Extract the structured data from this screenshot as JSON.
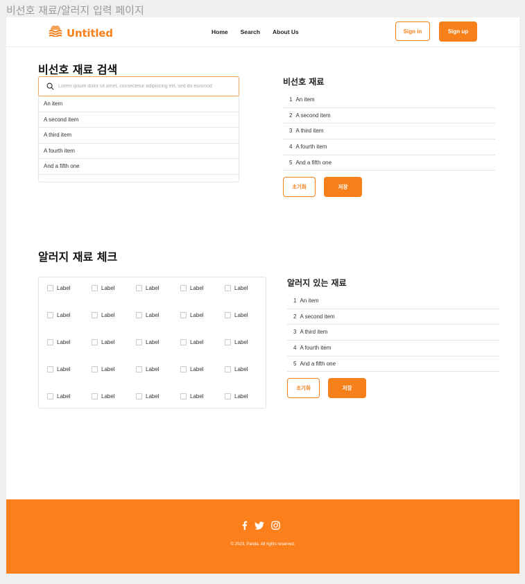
{
  "frame_title": "비선호 재료/알러지 입력 페이지",
  "header": {
    "brand": "Untitled",
    "nav": [
      "Home",
      "Search",
      "About Us"
    ],
    "sign_in": "Sign in",
    "sign_up": "Sign up"
  },
  "dislike": {
    "title": "비선호 재료 검색",
    "search_placeholder": "Lorem ipsum dolor sit amet, consectetur adipiscing elit, sed do eiusmod",
    "results": [
      "An item",
      "A second item",
      "A third item",
      "A fourth item",
      "And a fifth one"
    ],
    "selected_title": "비선호 재료",
    "selected": [
      {
        "num": "1",
        "label": "An item"
      },
      {
        "num": "2",
        "label": "A second item"
      },
      {
        "num": "3",
        "label": "A third item"
      },
      {
        "num": "4",
        "label": "A fourth item"
      },
      {
        "num": "5",
        "label": "And a fifth one"
      }
    ],
    "reset": "초기화",
    "save": "저장"
  },
  "allergy": {
    "title": "알러지 재료 체크",
    "checkbox_rows": [
      [
        "Label",
        "Label",
        "Label",
        "Label",
        "Label"
      ],
      [
        "Label",
        "Label",
        "Label",
        "Label",
        "Label"
      ],
      [
        "Label",
        "Label",
        "Label",
        "Label",
        "Label"
      ],
      [
        "Label",
        "Label",
        "Label",
        "Label",
        "Label"
      ],
      [
        "Label",
        "Label",
        "Label",
        "Label",
        "Label"
      ]
    ],
    "selected_title": "알러지 있는 재료",
    "selected": [
      {
        "num": "1",
        "label": "An item"
      },
      {
        "num": "2",
        "label": "A second item"
      },
      {
        "num": "3",
        "label": "A third item"
      },
      {
        "num": "4",
        "label": "A fourth item"
      },
      {
        "num": "5",
        "label": "And a fifth one"
      }
    ],
    "reset": "초기화",
    "save": "저장"
  },
  "footer": {
    "icons": [
      "facebook-icon",
      "twitter-icon",
      "instagram-icon"
    ],
    "copyright": "© 2023. Panda. All rights reserved."
  },
  "colors": {
    "accent": "#f7801a",
    "footer": "#fb7f1b"
  }
}
